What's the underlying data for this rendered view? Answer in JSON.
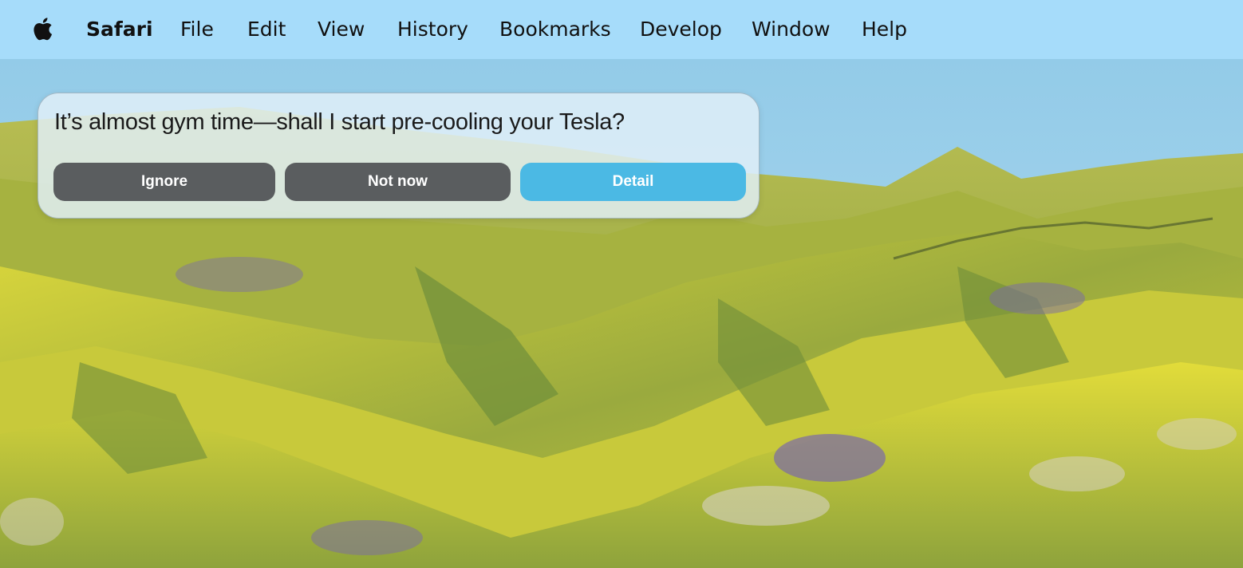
{
  "menubar": {
    "apple_icon": "apple-logo-icon",
    "app_name": "Safari",
    "items": [
      "File",
      "Edit",
      "View",
      "History",
      "Bookmarks",
      "Develop",
      "Window",
      "Help"
    ]
  },
  "notification": {
    "message": "It’s almost gym time—shall I start pre-cooling your Tesla?",
    "buttons": {
      "ignore": "Ignore",
      "not_now": "Not now",
      "detail": "Detail"
    }
  },
  "colors": {
    "menubar_bg": "#a6dcfa",
    "sky": "#8fc9ea",
    "button_dark": "#5a5d5f",
    "button_accent": "#4bb9e4",
    "hill_yellow": "#d9d63a",
    "hill_green": "#7e9a3c",
    "flower_purple": "#7a6aa8"
  }
}
